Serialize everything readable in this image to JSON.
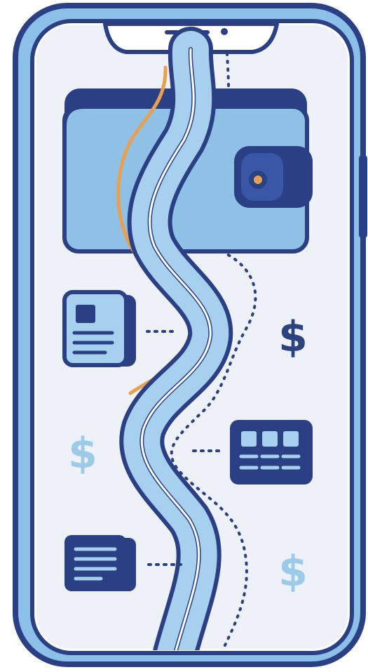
{
  "illustration": {
    "dollar_dark": "$",
    "dollar_light_left": "$",
    "dollar_light_right": "$"
  },
  "colors": {
    "navy": "#2a3f84",
    "phone_blue": "#8cc0e8",
    "screen_bg": "#eef2f8",
    "wallet_fill": "#8fc1e6",
    "river_fill": "#a6d0ee",
    "orange": "#e8a050",
    "light_dollar": "#9bcbe8",
    "dark_dollar": "#2d437f"
  },
  "icons": [
    "phone",
    "wallet",
    "river-path",
    "id-card-icon",
    "grid-icon",
    "document-icon",
    "dollar-icon"
  ]
}
